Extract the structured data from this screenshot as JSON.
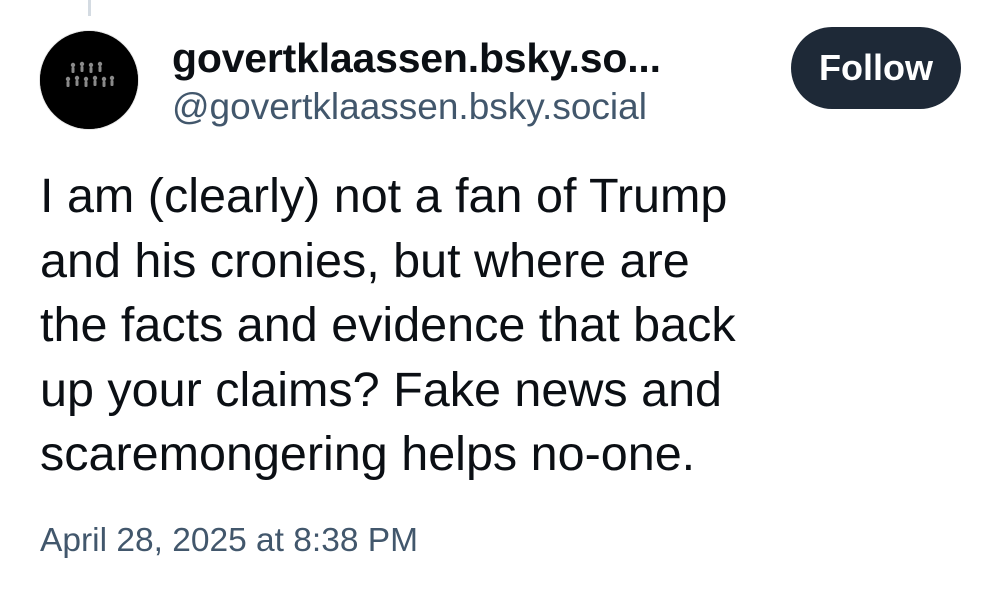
{
  "author": {
    "display_name": "govertklaassen.bsky.so...",
    "handle": "@govertklaassen.bsky.social",
    "avatar_icon": "profile-avatar"
  },
  "follow_button": {
    "label": "Follow",
    "background": "#1e2937",
    "text_color": "#ffffff"
  },
  "post": {
    "text_lines": [
      "I am (clearly) not a fan of Trump",
      "and his cronies, but where are",
      "the facts and evidence that back",
      "up your claims? Fake news and",
      "scaremongering helps no-one."
    ],
    "timestamp": "April 28, 2025 at 8:38 PM"
  },
  "colors": {
    "text_primary": "#0b0f14",
    "text_secondary": "#42576c",
    "thread_line": "#d4dbe2",
    "background": "#ffffff"
  }
}
